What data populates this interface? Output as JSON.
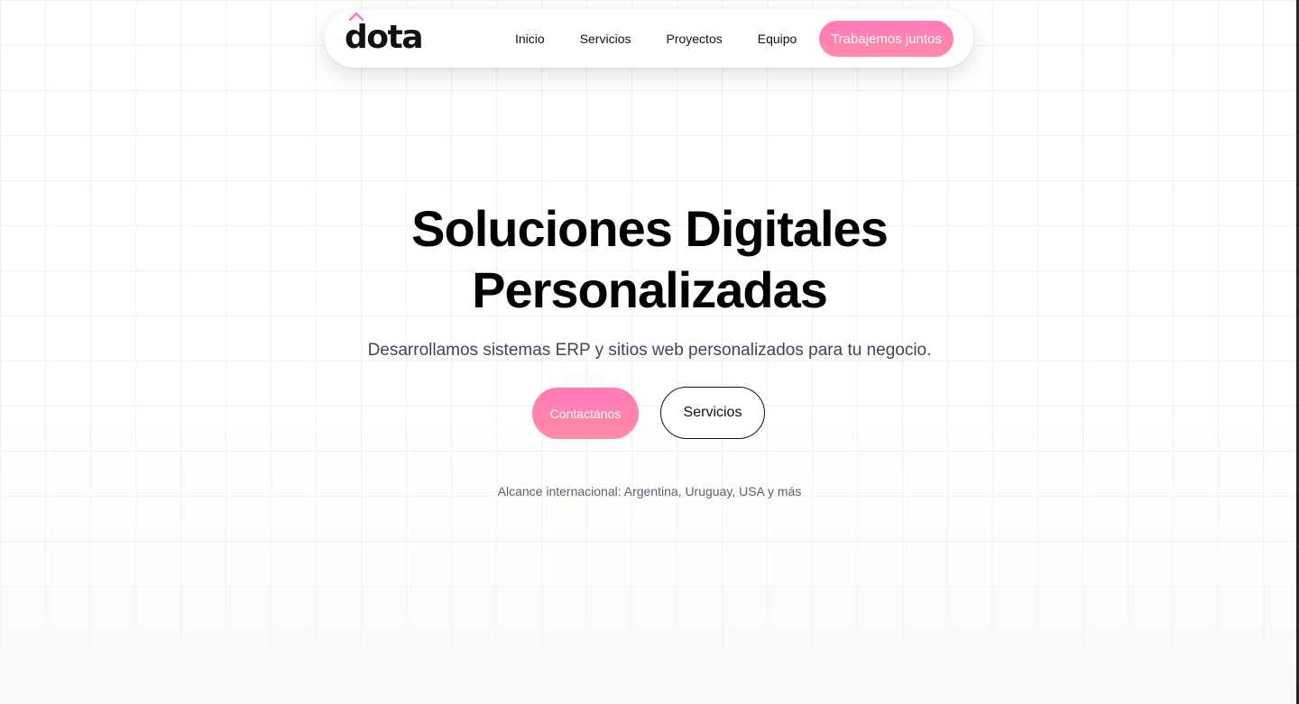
{
  "nav": {
    "logo": "dota",
    "links": [
      "Inicio",
      "Servicios",
      "Proyectos",
      "Equipo"
    ],
    "cta_label": "Trabajemos juntos"
  },
  "hero": {
    "title_line1": "Soluciones Digitales",
    "title_line2": "Personalizadas",
    "subtitle": "Desarrollamos sistemas ERP y sitios web personalizados para tu negocio.",
    "primary_button": "Contactános",
    "secondary_button": "Servicios",
    "reach": "Alcance internacional: Argentina, Uruguay, USA y más"
  },
  "colors": {
    "accent": "#ff7ab8",
    "text": "#000000",
    "muted": "#3f4656"
  }
}
